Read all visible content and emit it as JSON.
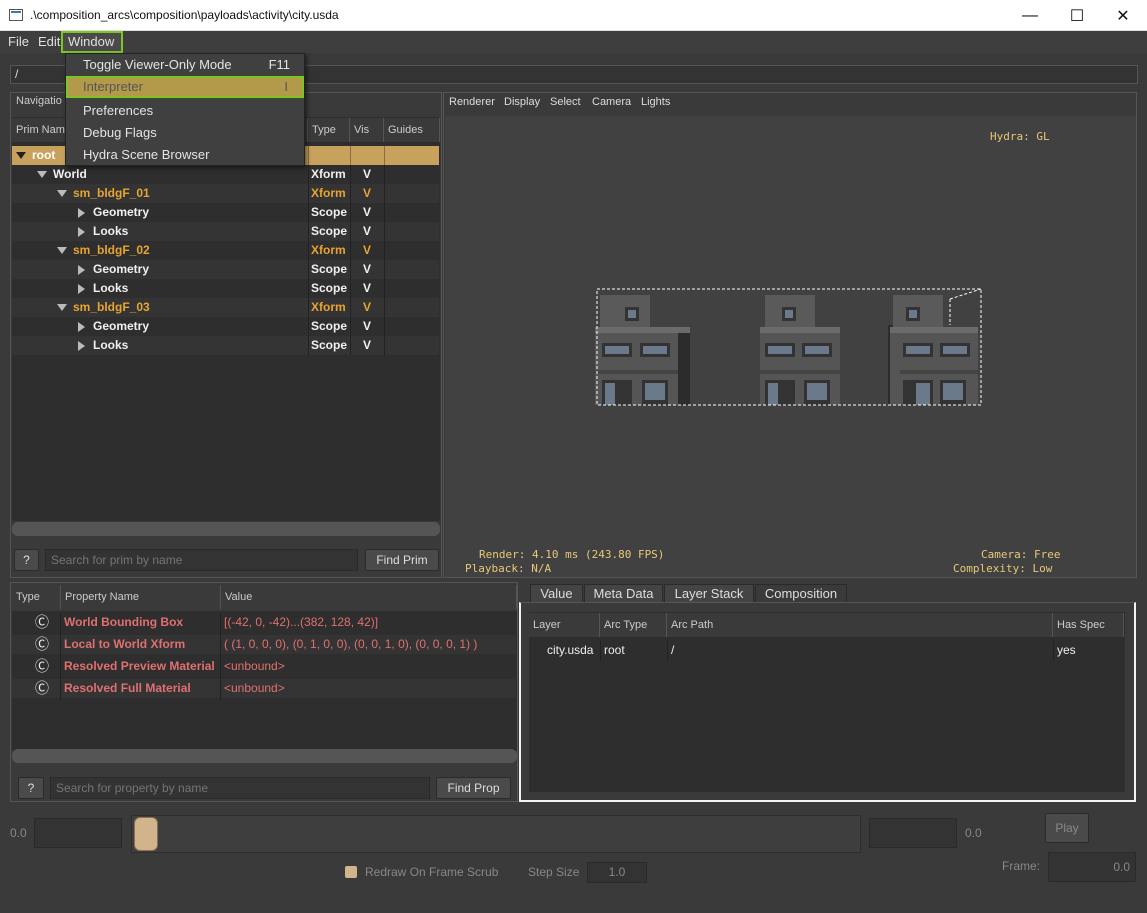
{
  "window": {
    "title": ".\\composition_arcs\\composition\\payloads\\activity\\city.usda",
    "minimize": "—",
    "maximize": "☐",
    "close": "✕"
  },
  "menubar": {
    "file": "File",
    "edit": "Edit",
    "window": "Window"
  },
  "window_menu": {
    "items": [
      {
        "label": "Toggle Viewer-Only Mode",
        "shortcut": "F11"
      },
      {
        "label": "Interpreter",
        "shortcut": "I"
      },
      {
        "label": "Preferences",
        "shortcut": ""
      },
      {
        "label": "Debug Flags",
        "shortcut": ""
      },
      {
        "label": "Hydra Scene Browser",
        "shortcut": ""
      }
    ]
  },
  "path": "/",
  "navigator": {
    "title": "Navigatio",
    "columns": {
      "name": "Prim Nam",
      "type": "Type",
      "vis": "Vis",
      "guides": "Guides"
    },
    "rows": [
      {
        "name": "root",
        "type": "",
        "vis": ""
      },
      {
        "name": "World",
        "type": "Xform",
        "vis": "V"
      },
      {
        "name": "sm_bldgF_01",
        "type": "Xform",
        "vis": "V"
      },
      {
        "name": "Geometry",
        "type": "Scope",
        "vis": "V"
      },
      {
        "name": "Looks",
        "type": "Scope",
        "vis": "V"
      },
      {
        "name": "sm_bldgF_02",
        "type": "Xform",
        "vis": "V"
      },
      {
        "name": "Geometry",
        "type": "Scope",
        "vis": "V"
      },
      {
        "name": "Looks",
        "type": "Scope",
        "vis": "V"
      },
      {
        "name": "sm_bldgF_03",
        "type": "Xform",
        "vis": "V"
      },
      {
        "name": "Geometry",
        "type": "Scope",
        "vis": "V"
      },
      {
        "name": "Looks",
        "type": "Scope",
        "vis": "V"
      }
    ],
    "help": "?",
    "search_placeholder": "Search for prim by name",
    "find_button": "Find Prim"
  },
  "viewport": {
    "menu": [
      "Renderer",
      "Display",
      "Select",
      "Camera",
      "Lights"
    ],
    "hud_renderer": "Hydra: GL",
    "hud_render": "Render: 4.10 ms (243.80 FPS)",
    "hud_playback": "Playback: N/A",
    "hud_camera": "Camera: Free",
    "hud_complexity": "Complexity: Low"
  },
  "properties": {
    "columns": {
      "type": "Type",
      "name": "Property Name",
      "value": "Value"
    },
    "rows": [
      {
        "icon": "Ⓒ",
        "name": "World Bounding Box",
        "value": "[(-42, 0, -42)...(382, 128, 42)]"
      },
      {
        "icon": "Ⓒ",
        "name": "Local to World Xform",
        "value": "( (1, 0, 0, 0), (0, 1, 0, 0), (0, 0, 1, 0), (0, 0, 0, 1) )"
      },
      {
        "icon": "Ⓒ",
        "name": "Resolved Preview Material",
        "value": "<unbound>"
      },
      {
        "icon": "Ⓒ",
        "name": "Resolved Full Material",
        "value": "<unbound>"
      }
    ],
    "help": "?",
    "search_placeholder": "Search for property by name",
    "find_button": "Find Prop"
  },
  "inspector": {
    "tabs": [
      "Value",
      "Meta Data",
      "Layer Stack",
      "Composition"
    ],
    "columns": {
      "layer": "Layer",
      "arc_type": "Arc Type",
      "arc_path": "Arc Path",
      "has_spec": "Has Spec"
    },
    "rows": [
      {
        "layer": "city.usda",
        "arc_type": "root",
        "arc_path": "/",
        "has_spec": "yes"
      }
    ]
  },
  "timeline": {
    "start": "0.0",
    "end": "0.0",
    "play": "Play",
    "redraw_label": "Redraw On Frame Scrub",
    "step_label": "Step Size",
    "step_value": "1.0",
    "frame_label": "Frame:",
    "frame_value": "0.0"
  }
}
